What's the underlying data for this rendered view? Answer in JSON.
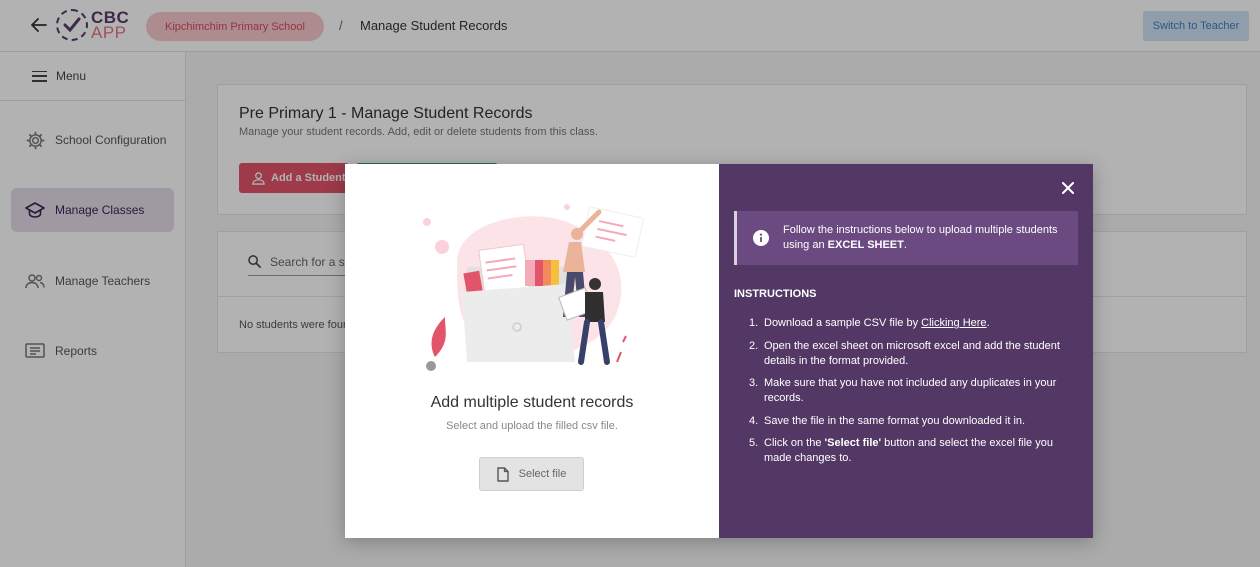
{
  "app": {
    "name_line1": "CBC",
    "name_line2": "APP"
  },
  "header": {
    "school_name": "Kipchimchim Primary School",
    "breadcrumb_separator": "/",
    "breadcrumb_current": "Manage Student Records",
    "switch_label": "Switch to Teacher"
  },
  "sidebar": {
    "menu_label": "Menu",
    "items": [
      {
        "label": "School Configuration",
        "icon": "gear-icon",
        "active": false
      },
      {
        "label": "Manage Classes",
        "icon": "graduation-cap-icon",
        "active": true
      },
      {
        "label": "Manage Teachers",
        "icon": "users-icon",
        "active": false
      },
      {
        "label": "Reports",
        "icon": "report-icon",
        "active": false
      }
    ]
  },
  "main": {
    "title": "Pre Primary 1 - Manage Student Records",
    "subtitle": "Manage your student records. Add, edit or delete students from this class.",
    "add_student_label": "Add a Student",
    "search_placeholder": "Search for a s",
    "empty_message": "No students were foun"
  },
  "modal": {
    "title": "Add multiple student records",
    "subtitle": "Select and upload the filled csv file.",
    "select_file_label": "Select file",
    "alert_text_1": "Follow the instructions below to upload multiple students using an ",
    "alert_text_bold": "EXCEL SHEET",
    "alert_text_2": ".",
    "instructions_title": "INSTRUCTIONS",
    "steps": [
      {
        "num": "1.",
        "before": "Download a sample CSV file by ",
        "link": "Clicking Here",
        "after": "."
      },
      {
        "num": "2.",
        "before": "Open the excel sheet on microsoft excel and add the student details in the format provided.",
        "link": "",
        "after": ""
      },
      {
        "num": "3.",
        "before": "Make sure that you have not included any duplicates in your records.",
        "link": "",
        "after": ""
      },
      {
        "num": "4.",
        "before": "Save the file in the same format you downloaded it in.",
        "link": "",
        "after": ""
      },
      {
        "num": "5.",
        "before": "Click on the ",
        "bold": "'Select file'",
        "after": " button and select the excel file you made changes to."
      }
    ]
  },
  "colors": {
    "brand_purple": "#533865",
    "accent_pink": "#e2546a",
    "success_green": "#2e9b5a",
    "switch_blue": "#3f7cc2"
  }
}
